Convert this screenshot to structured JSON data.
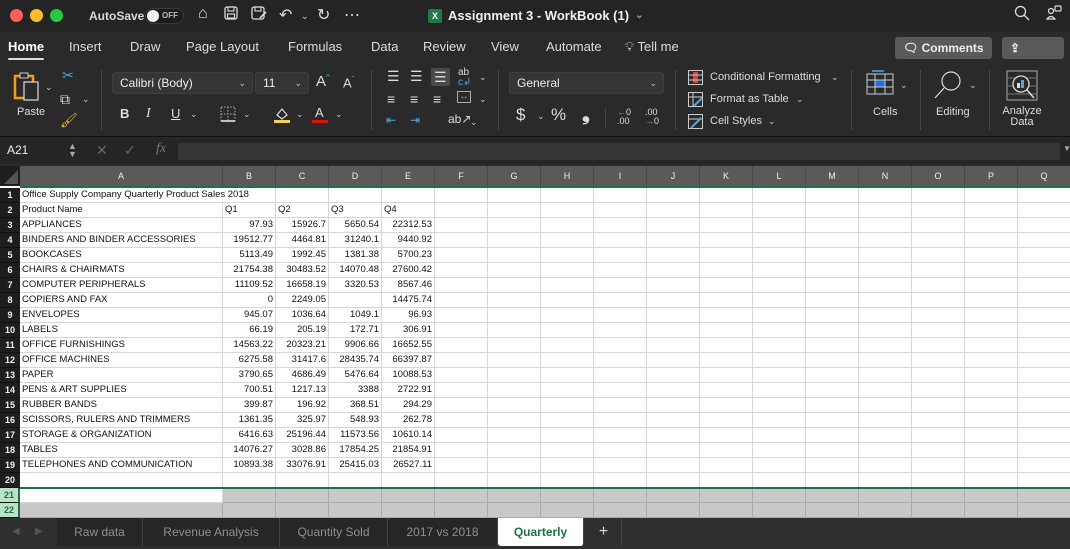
{
  "titlebar": {
    "autosave_label": "AutoSave",
    "autosave_state": "OFF",
    "document_title": "Assignment 3 - WorkBook (1)",
    "title_chevron": "⌄",
    "quick_access_icons": [
      "home-icon",
      "save-icon",
      "save-as-icon",
      "undo-icon",
      "redo-icon",
      "more-icon"
    ]
  },
  "menu": {
    "tabs": [
      "Home",
      "Insert",
      "Draw",
      "Page Layout",
      "Formulas",
      "Data",
      "Review",
      "View",
      "Automate"
    ],
    "active_tab": "Home",
    "tell_me": "Tell me",
    "comments": "Comments",
    "share": "Share"
  },
  "ribbon": {
    "paste": "Paste",
    "font_name": "Calibri (Body)",
    "font_size": "11",
    "bold": "B",
    "italic": "I",
    "underline": "U",
    "number_format": "General",
    "currency": "$",
    "percent": "%",
    "comma": "❟",
    "conditional_formatting": "Conditional Formatting",
    "format_as_table": "Format as Table",
    "cell_styles": "Cell Styles",
    "cells": "Cells",
    "editing": "Editing",
    "analyze_data_line1": "Analyze",
    "analyze_data_line2": "Data",
    "fill_color": "#f7d154",
    "font_color": "#e01010"
  },
  "formula_bar": {
    "name_box": "A21",
    "fx": "fx",
    "formula": ""
  },
  "sheet": {
    "columns": [
      "A",
      "B",
      "C",
      "D",
      "E",
      "F",
      "G",
      "H",
      "I",
      "J",
      "K",
      "L",
      "M",
      "N",
      "O",
      "P",
      "Q"
    ],
    "title": "Office Supply Company Quarterly Product Sales 2018",
    "headers": [
      "Product Name",
      "Q1",
      "Q2",
      "Q3",
      "Q4"
    ],
    "rows": [
      [
        "APPLIANCES",
        "97.93",
        "15926.7",
        "5650.54",
        "22312.53"
      ],
      [
        "BINDERS AND BINDER ACCESSORIES",
        "19512.77",
        "4464.81",
        "31240.1",
        "9440.92"
      ],
      [
        "BOOKCASES",
        "5113.49",
        "1992.45",
        "1381.38",
        "5700.23"
      ],
      [
        "CHAIRS & CHAIRMATS",
        "21754.38",
        "30483.52",
        "14070.48",
        "27600.42"
      ],
      [
        "COMPUTER PERIPHERALS",
        "11109.52",
        "16658.19",
        "3320.53",
        "8567.46"
      ],
      [
        "COPIERS AND FAX",
        "0",
        "2249.05",
        "",
        "14475.74"
      ],
      [
        "ENVELOPES",
        "945.07",
        "1036.64",
        "1049.1",
        "96.93"
      ],
      [
        "LABELS",
        "66.19",
        "205.19",
        "172.71",
        "306.91"
      ],
      [
        "OFFICE FURNISHINGS",
        "14563.22",
        "20323.21",
        "9906.66",
        "16652.55"
      ],
      [
        "OFFICE MACHINES",
        "6275.58",
        "31417.6",
        "28435.74",
        "66397.87"
      ],
      [
        "PAPER",
        "3790.65",
        "4686.49",
        "5476.64",
        "10088.53"
      ],
      [
        "PENS & ART SUPPLIES",
        "700.51",
        "1217.13",
        "3388",
        "2722.91"
      ],
      [
        "RUBBER BANDS",
        "399.87",
        "196.92",
        "368.51",
        "294.29"
      ],
      [
        "SCISSORS, RULERS AND TRIMMERS",
        "1361.35",
        "325.97",
        "548.93",
        "262.78"
      ],
      [
        "STORAGE & ORGANIZATION",
        "6416.63",
        "25196.44",
        "11573.56",
        "10610.14"
      ],
      [
        "TABLES",
        "14076.27",
        "3028.86",
        "17854.25",
        "21854.91"
      ],
      [
        "TELEPHONES AND COMMUNICATION",
        "10893.38",
        "33076.91",
        "25415.03",
        "26527.11"
      ]
    ],
    "row_numbers": [
      "1",
      "2",
      "3",
      "4",
      "5",
      "6",
      "7",
      "8",
      "9",
      "10",
      "11",
      "12",
      "13",
      "14",
      "15",
      "16",
      "17",
      "18",
      "19",
      "20",
      "21",
      "22"
    ],
    "selected_rows": [
      "21",
      "22"
    ]
  },
  "sheet_tabs": {
    "tabs": [
      "Raw data",
      "Revenue Analysis",
      "Quantity Sold",
      "2017 vs 2018",
      "Quarterly"
    ],
    "active": "Quarterly",
    "add": "+"
  }
}
